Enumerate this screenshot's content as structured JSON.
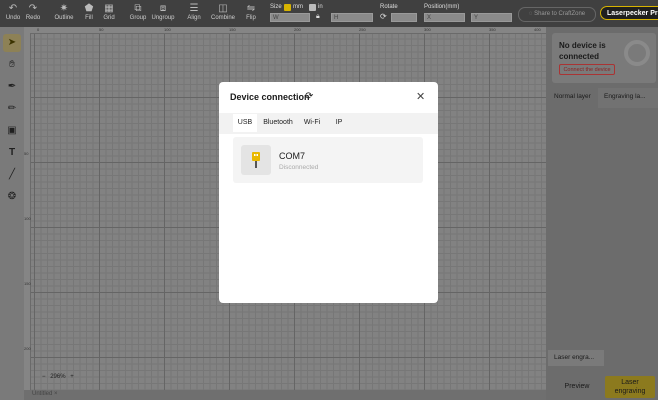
{
  "toolbar": {
    "undo": "Undo",
    "redo": "Redo",
    "outline": "Outline",
    "fill": "Fill",
    "grid": "Grid",
    "group": "Group",
    "ungroup": "Ungroup",
    "align": "Align",
    "combine": "Combine",
    "flip": "Flip",
    "size_label": "Size",
    "unit_mm": "mm",
    "unit_in": "in",
    "w_placeholder": "W",
    "h_placeholder": "H",
    "rotate_label": "Rotate",
    "position_label": "Position(mm)",
    "x_placeholder": "X",
    "y_placeholder": "Y",
    "share": "Share to CraftZone",
    "brand": "Laserpecker Pro",
    "accent_color": "#d7b300"
  },
  "ruler": {
    "top": [
      "0",
      "50",
      "100",
      "150",
      "200",
      "250",
      "300",
      "350",
      "400"
    ],
    "left": [
      "50",
      "100",
      "150",
      "200"
    ]
  },
  "canvas": {
    "zoom": "296%",
    "zoom_minus": "−",
    "zoom_plus": "+"
  },
  "status": {
    "tab": "Untitled ×"
  },
  "right_panel": {
    "no_device": "No device is connected",
    "connect_button": "Connect the device",
    "tab_normal": "Normal layer",
    "tab_engraving": "Engraving la...",
    "laser_engraving": "Laser engra...",
    "preview": "Preview",
    "laser_button": "Laser engraving"
  },
  "modal": {
    "title": "Device connection",
    "tabs": [
      "USB",
      "Bluetooth",
      "Wi-Fi",
      "IP"
    ],
    "selected_tab": "USB",
    "device_name": "COM7",
    "device_status": "Disconnected",
    "usb_color": "#e9b800"
  }
}
